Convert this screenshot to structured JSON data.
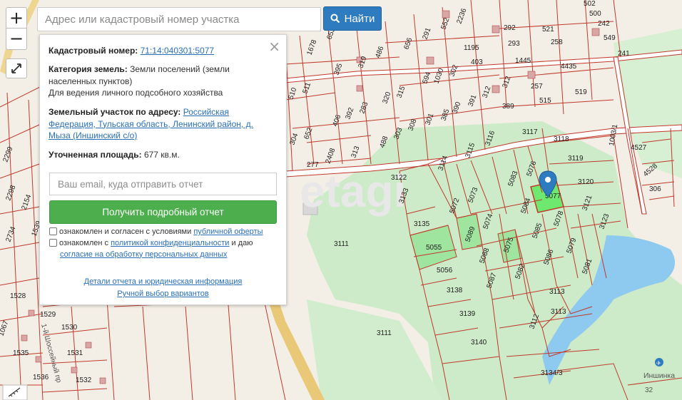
{
  "search": {
    "placeholder": "Адрес или кадастровый номер участка",
    "button_label": "Найти"
  },
  "zoom": {
    "in_label": "+",
    "out_label": "−"
  },
  "panel": {
    "close_label": "×",
    "cadastral_label": "Кадастровый номер:",
    "cadastral_value": "71:14:040301:5077",
    "category_label": "Категория земель:",
    "category_value": "Земли поселений (земли населенных пунктов)",
    "usage_value": "Для ведения личного подсобного хозяйства",
    "address_label": "Земельный участок по адресу:",
    "address_value": "Российская Федерация, Тульская область, Ленинский район, д. Мыза (Иншинский с/о)",
    "area_label": "Уточненная площадь:",
    "area_value": "677 кв.м.",
    "email_placeholder": "Ваш email, куда отправить отчет",
    "report_button": "Получить подробный отчет",
    "terms1_text": "ознакомлен и согласен с условиями",
    "terms1_link": "публичной оферты",
    "terms2_text_a": "ознакомлен с",
    "terms2_link_a": "политикой конфиденциальности",
    "terms2_text_b": "и даю",
    "terms2_link_b": "согласие на обработку персональных данных",
    "details_link": "Детали отчета и юридическая информация",
    "manual_link": "Ручной выбор вариантов"
  },
  "map": {
    "watermark": "etagi",
    "place_name": "Иншинка",
    "road_number": "32",
    "road_label": "1-й Шоссейный пр",
    "colors": {
      "boundary": "#c0392b",
      "selected": "#6fe86f",
      "parcel_green": "#9fe59f",
      "water": "#8ec9ef",
      "forest": "#cdebc8",
      "road": "#e9c878"
    },
    "labels": [
      "3111",
      "3111",
      "3122",
      "3133",
      "3135",
      "5055",
      "5056",
      "3138",
      "3139",
      "3140",
      "3134/3",
      "5072",
      "5073",
      "5074",
      "5089",
      "5088",
      "5087",
      "5075",
      "5082",
      "5083",
      "5084",
      "5085",
      "5086",
      "5076",
      "5078",
      "5079",
      "5081",
      "3113",
      "3113",
      "3112",
      "3114",
      "3115",
      "3116",
      "3117",
      "3118",
      "3119",
      "3120",
      "3121",
      "3123",
      "306",
      "4528",
      "4527",
      "1003/1",
      "4435",
      "519",
      "515",
      "257",
      "258",
      "1445",
      "293",
      "292",
      "521",
      "241",
      "549",
      "242",
      "500",
      "502",
      "389",
      "312",
      "312",
      "391",
      "390",
      "385",
      "301",
      "308",
      "303",
      "488",
      "313",
      "2408",
      "277",
      "652",
      "304",
      "406",
      "392",
      "283",
      "320",
      "315",
      "594",
      "1030",
      "302",
      "403",
      "1195",
      "656",
      "291",
      "552",
      "2236",
      "319",
      "486",
      "395",
      "511",
      "1678",
      "653",
      "510",
      "2299",
      "2298",
      "2154",
      "1539",
      "2734",
      "1528",
      "1529",
      "1530",
      "1531",
      "1532",
      "1535",
      "1536",
      "1067",
      "5077"
    ]
  }
}
